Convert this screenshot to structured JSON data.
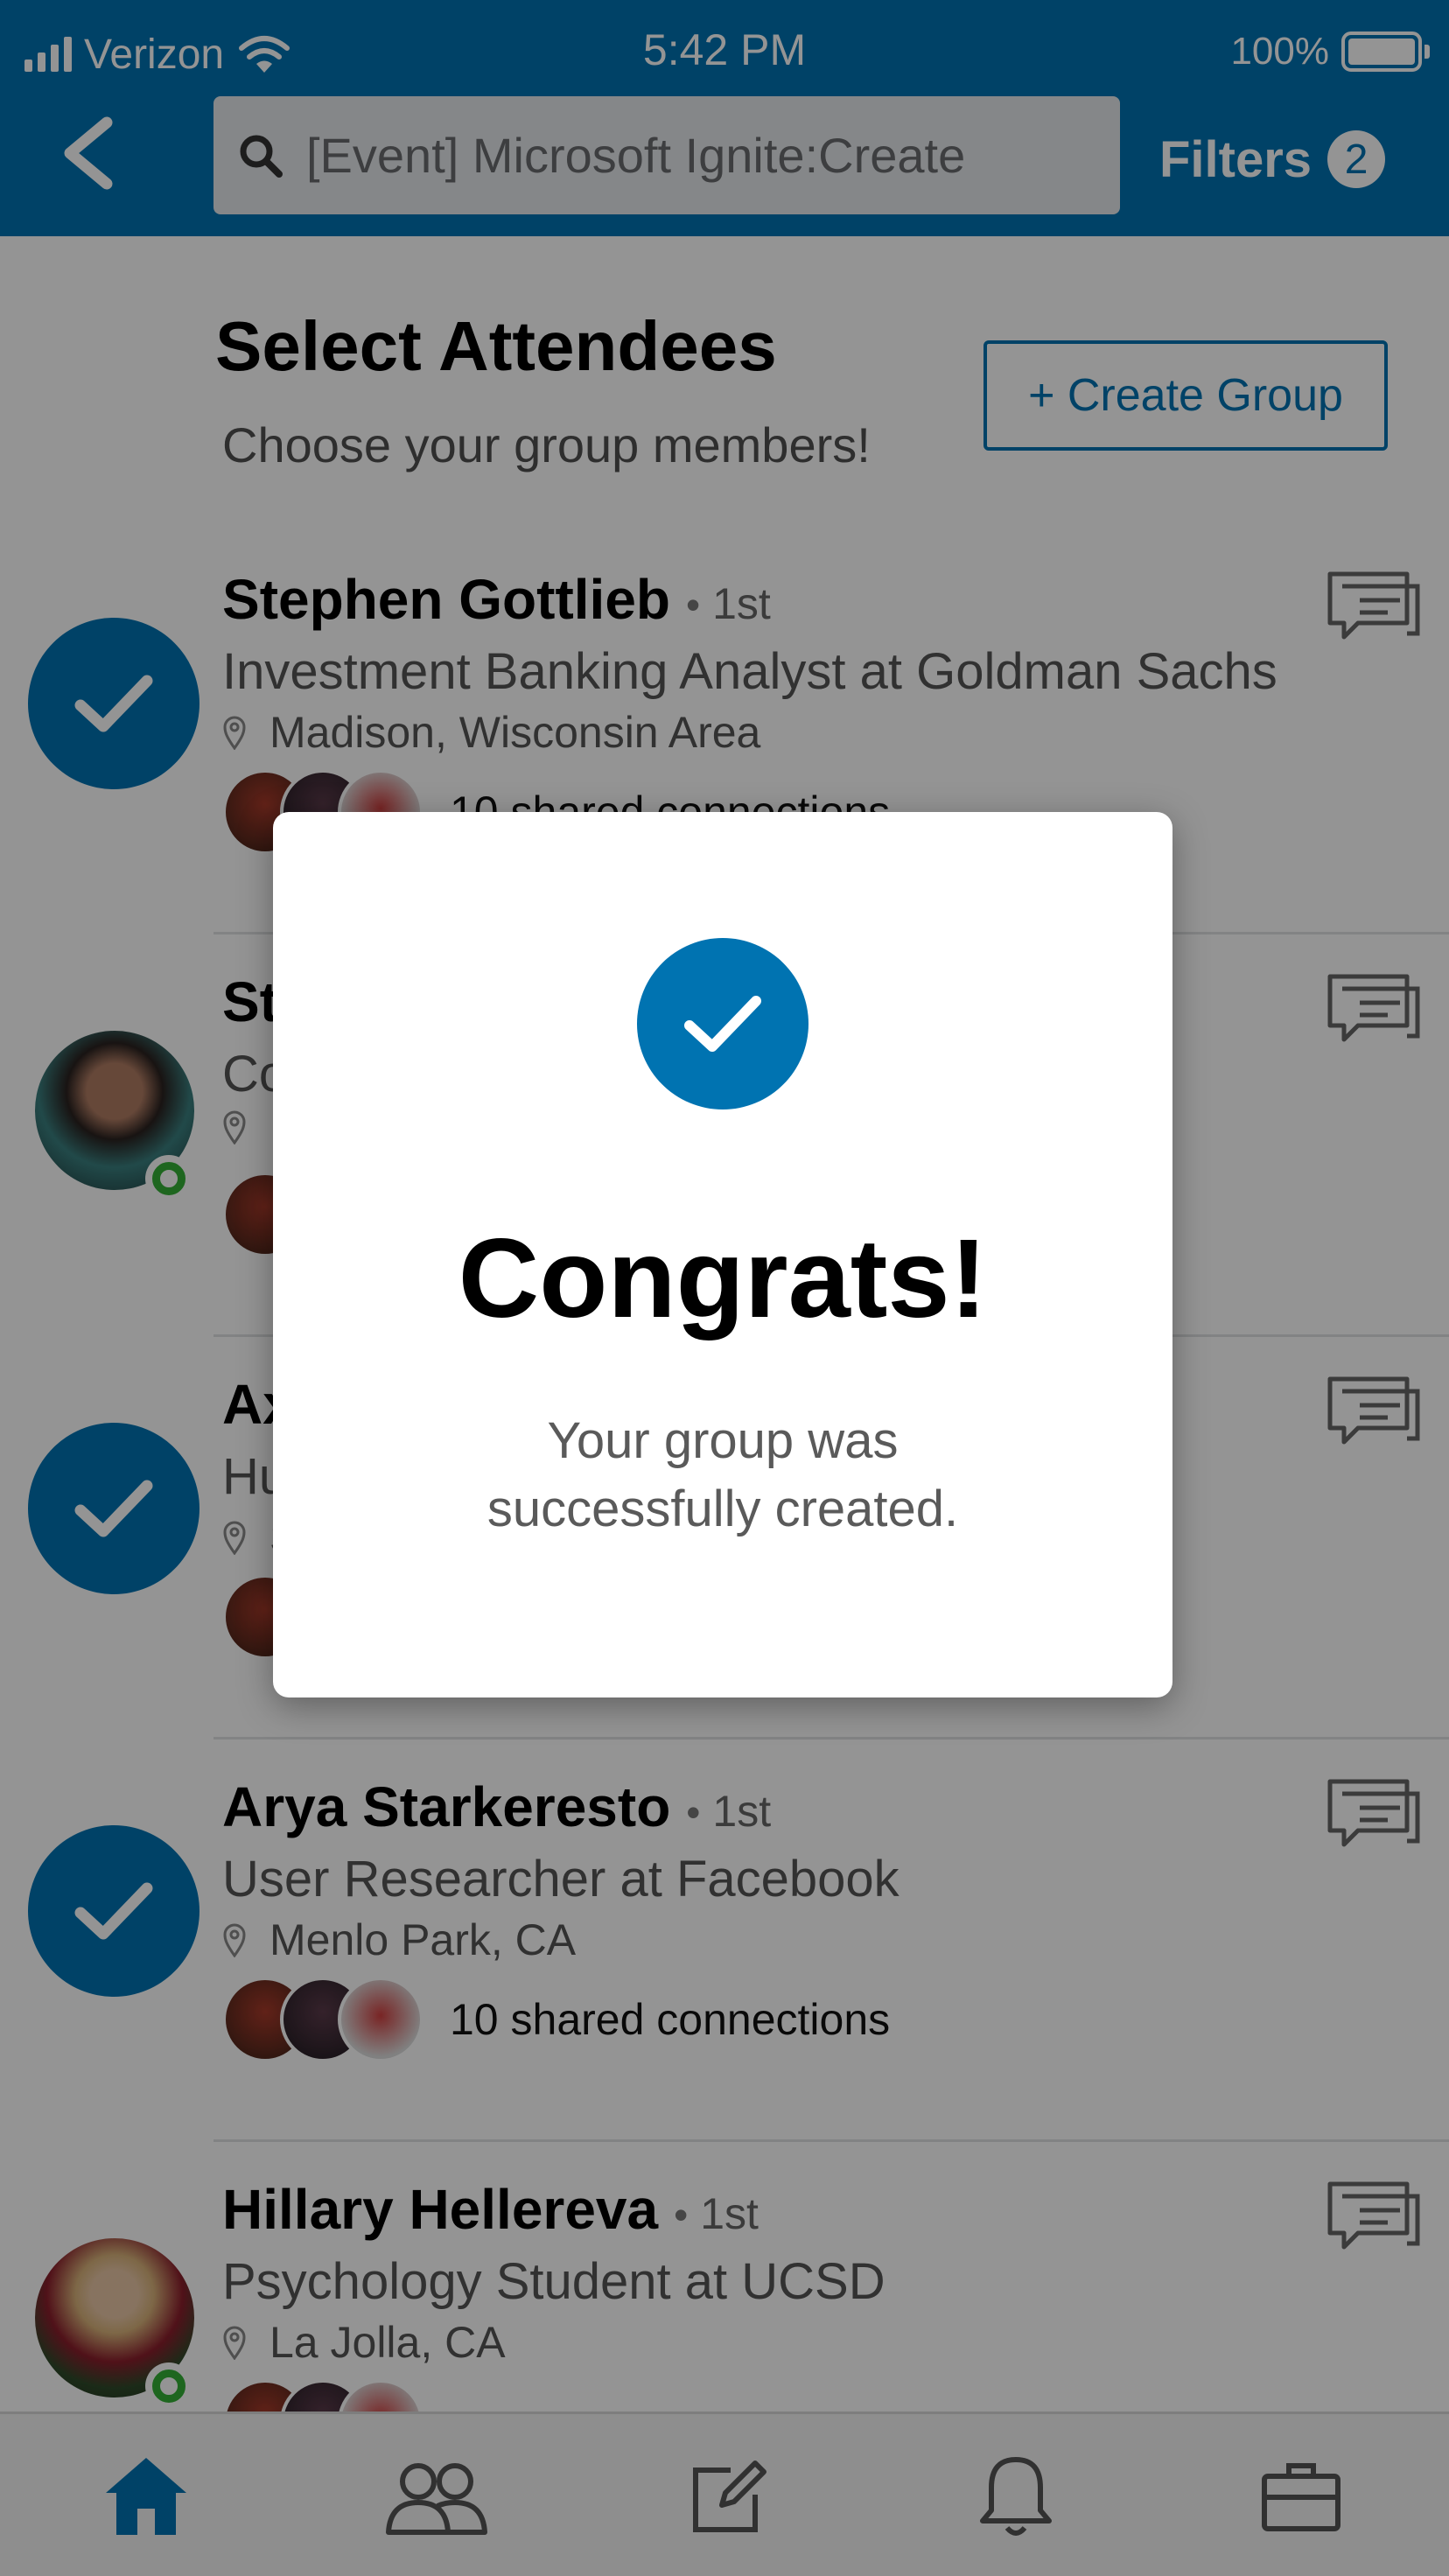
{
  "status_bar": {
    "carrier": "Verizon",
    "time": "5:42 PM",
    "battery": "100%"
  },
  "header": {
    "search_text": "[Event] Microsoft Ignite:Create",
    "filters_label": "Filters",
    "filters_count": "2"
  },
  "page": {
    "title": "Select Attendees",
    "subtitle": "Choose your group members!",
    "create_group_label": "+ Create Group"
  },
  "attendees": [
    {
      "name": "Stephen Gottlieb",
      "degree": "1st",
      "headline": "Investment Banking Analyst at Goldman Sachs",
      "location": "Madison, Wisconsin Area",
      "shared": "10 shared connections",
      "selected": true
    },
    {
      "name": "St",
      "degree": "",
      "headline": "Co",
      "location": "",
      "shared": "",
      "selected": false,
      "online": true
    },
    {
      "name": "Ax",
      "degree": "",
      "headline": "Hu",
      "location": "S",
      "shared": "",
      "selected": true
    },
    {
      "name": "Arya Starkeresto",
      "degree": "1st",
      "headline": "User Researcher at Facebook",
      "location": "Menlo Park, CA",
      "shared": "10 shared connections",
      "selected": true
    },
    {
      "name": "Hillary Hellereva",
      "degree": "1st",
      "headline": "Psychology Student at UCSD",
      "location": "La Jolla, CA",
      "shared": "",
      "selected": false,
      "online": true
    }
  ],
  "nav": {
    "items": [
      {
        "icon": "home-icon",
        "active": true
      },
      {
        "icon": "network-icon",
        "active": false
      },
      {
        "icon": "compose-icon",
        "active": false
      },
      {
        "icon": "notifications-icon",
        "active": false
      },
      {
        "icon": "jobs-icon",
        "active": false
      }
    ]
  },
  "modal": {
    "title": "Congrats!",
    "message": "Your group was successfully created."
  },
  "colors": {
    "brand": "#0073b1",
    "online": "#34b036"
  }
}
